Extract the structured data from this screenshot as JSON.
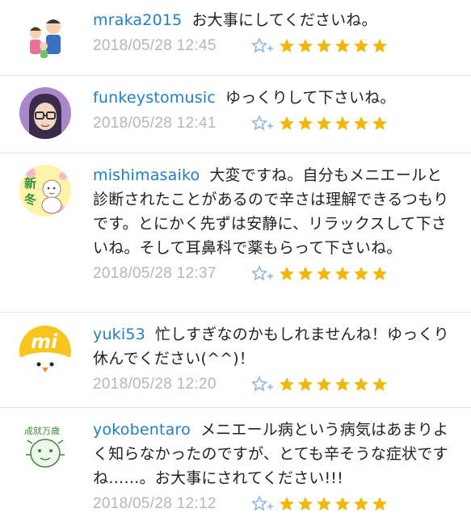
{
  "colors": {
    "username": "#1f7fc4",
    "timestamp": "#b6b6b6",
    "star": "#f2b705",
    "star_add": "#8ab4e8",
    "divider": "#e3e3e3"
  },
  "comments": [
    {
      "username": "mraka2015",
      "text": "お大事にしてくださいね。",
      "timestamp": "2018/05/28 12:45",
      "stars": 6,
      "avatar_icon": "family-avatar-icon"
    },
    {
      "username": "funkeystomusic",
      "text": "ゆっくりして下さいね。",
      "timestamp": "2018/05/28 12:41",
      "stars": 6,
      "avatar_icon": "glasses-person-avatar-icon"
    },
    {
      "username": "mishimasaiko",
      "text": "大変ですね。自分もメニエールと診断されたことがあるので辛さは理解できるつもりです。とにかく先ずは安静に、リラックスして下さいね。そして耳鼻科で薬もらって下さいね。",
      "timestamp": "2018/05/28 12:37",
      "stars": 6,
      "avatar_icon": "shinto-baby-avatar-icon",
      "avatar_text": "新冬"
    },
    {
      "username": "yuki53",
      "text": "忙しすぎなのかもしれませんね！ゆっくり休んでください(^^)！",
      "timestamp": "2018/05/28 12:20",
      "stars": 6,
      "avatar_icon": "chick-avatar-icon",
      "avatar_text": "mi"
    },
    {
      "username": "yokobentaro",
      "text": "メニエール病という病気はあまりよく知らなかったのですが、とても辛そうな症状ですね……。お大事にされてください!!!",
      "timestamp": "2018/05/28 12:12",
      "stars": 6,
      "avatar_icon": "stamp-face-avatar-icon",
      "avatar_text": "成就万歳"
    }
  ]
}
